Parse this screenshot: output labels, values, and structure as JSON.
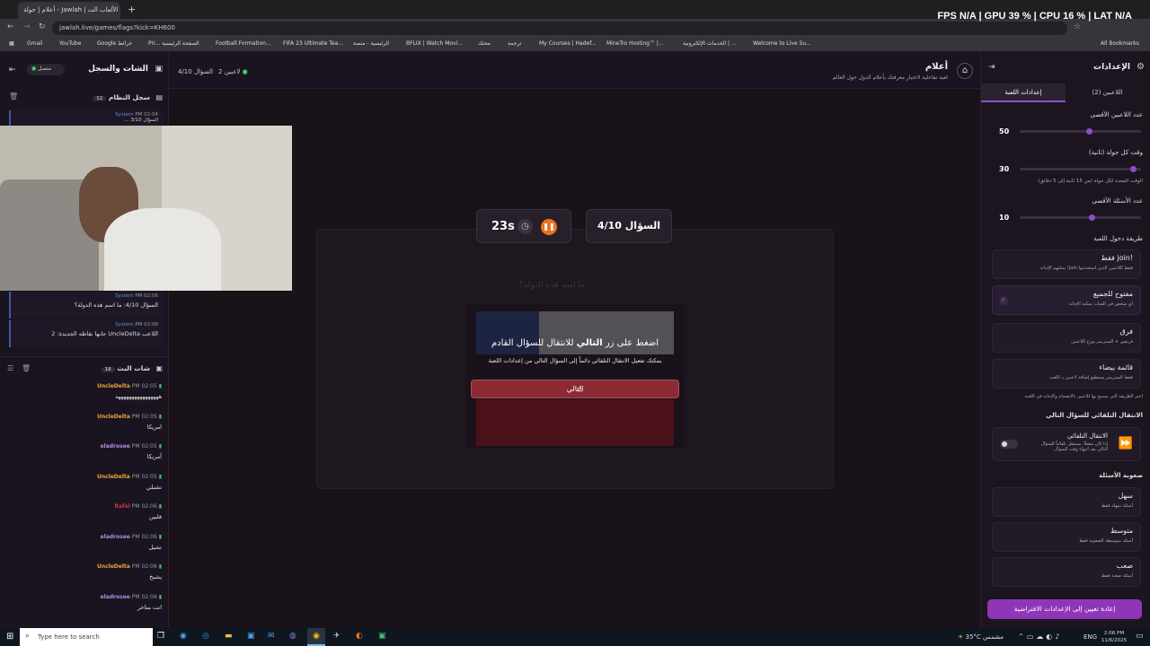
{
  "browser": {
    "tab_title": "أعلام | جولة - Jawlah | منصة الألعاب الت...",
    "url": "jawlah.live/games/flags?kick=KH600",
    "bookmarks": [
      "Gmail",
      "YouTube",
      "Google خرائط",
      "Pri... الصفحة الرئيسية",
      "Football Formation...",
      "FIFA 23 Ultimate Tea...",
      "الرئيسية - منصة",
      "BFLIX | Watch Movi...",
      "محتك",
      "ترجمة",
      "My Courses | Hadef...",
      "MineTro Hosting™ |...",
      "الخدمات الإلكترونية | ...",
      "Welcome to Live Su..."
    ],
    "all_bookmarks": "All Bookmarks"
  },
  "overlay": {
    "fps_label": "FPS",
    "fps": "N/A",
    "gpu_label": "GPU",
    "gpu": "39 %",
    "cpu_label": "CPU",
    "cpu": "16 %",
    "lat_label": "LAT",
    "lat": "N/A"
  },
  "header": {
    "title": "أعلام",
    "subtitle": "لعبة تفاعلية لاختبار معرفتك بأعلام الدول حول العالم",
    "question_counter": "السؤال 4/10",
    "players": "2 لاعبين"
  },
  "game": {
    "question_label": "السؤال 4/10",
    "timer": "23s",
    "hidden_prompt": "ما اسم هذه الدولة؟",
    "modal_title_pre": "اضغط على زر ",
    "modal_title_bold": "التالي",
    "modal_title_post": " للانتقال للسؤال القادم",
    "modal_sub": "يمكنك تفعيل الانتقال التلقائي دائماً إلى السؤال التالي من إعدادات اللعبة",
    "next_button": "التالي"
  },
  "left": {
    "title": "الشات والسجل",
    "connected": "متصل",
    "system_log": "سجل النظام",
    "system_count": "12",
    "log": [
      {
        "user": "System",
        "time": "PM 02:04",
        "text": "السؤال 3/10 ..."
      },
      {
        "user": "System",
        "time": "PM 02:06",
        "text": "السؤال 4/10: ما اسم هذه الدولة؟"
      },
      {
        "user": "System",
        "time": "PM 02:06",
        "text": "اللاعب UncleDelta جابها نقاطه الجديدة: 2"
      }
    ],
    "chat_title": "شات البث",
    "chat_count": "18",
    "chat": [
      {
        "user": "UncleDelta",
        "time": "PM 02:05",
        "text": "ههههههههههههههههه",
        "color": "#f0a23c"
      },
      {
        "user": "UncleDelta",
        "time": "PM 02:05",
        "text": "امريكا",
        "color": "#f0a23c"
      },
      {
        "user": "eladrosee",
        "time": "PM 02:05",
        "text": "أمريكا",
        "color": "#b48ce0"
      },
      {
        "user": "UncleDelta",
        "time": "PM 02:05",
        "text": "تشيلي",
        "color": "#f0a23c"
      },
      {
        "user": "Rafel",
        "time": "PM 02:06",
        "text": "فلبين",
        "color": "#d0304a"
      },
      {
        "user": "eladrosee",
        "time": "PM 02:06",
        "text": "تشيل",
        "color": "#b48ce0"
      },
      {
        "user": "UncleDelta",
        "time": "PM 02:06",
        "text": "يشبخ",
        "color": "#f0a23c"
      },
      {
        "user": "eladrosee",
        "time": "PM 02:06",
        "text": "انت متاخر",
        "color": "#b48ce0"
      }
    ]
  },
  "settings": {
    "title": "الإعدادات",
    "tab_players": "اللاعبين (2)",
    "tab_game": "إعدادات اللعبة",
    "max_players_label": "عدد اللاعبين الأقصى",
    "max_players": "50",
    "max_players_fraction": 0.42,
    "round_time_label": "وقت كل جولة (ثانية)",
    "round_time": "30",
    "round_time_fraction": 0.04,
    "round_time_hint": "الوقت المحدد لكل جولة (من 15 ثانية إلى 5 دقائق)",
    "max_questions_label": "عدد الأسئلة الأقصى",
    "max_questions": "10",
    "max_questions_fraction": 0.4,
    "join_method_label": "طريقة دخول اللعبة",
    "join_options": [
      {
        "title": "!join فقط",
        "sub": "فقط اللاعبين الذين استخدموا join! يمكنهم الإجابة"
      },
      {
        "title": "مفتوح للجميع",
        "sub": "أي شخص في الشات يمكنه الإجابة"
      },
      {
        "title": "فرق",
        "sub": "فريقين + الستريمر يوزع اللاعبين"
      },
      {
        "title": "قائمة بيضاء",
        "sub": "فقط الستريمر يستطيع إضافة لاعبين يـ اللعب"
      }
    ],
    "join_hint": "اختر الطريقة التي يسمح بها للاعبين بالانضمام والإجابة في اللعبة",
    "auto_label": "الانتقال التلقائي للسؤال التالي",
    "auto_title": "الانتقال التلقائي",
    "auto_sub": "إذا كان مفعلاً، سينتقل تلقائياً للسؤال التالي بعد انتهاء وقت السؤال.",
    "difficulty_label": "صعوبة الأسئلة",
    "difficulties": [
      {
        "title": "سهل",
        "sub": "أسئلة سهلة فقط"
      },
      {
        "title": "متوسط",
        "sub": "أسئلة متوسطة الصعوبة فقط"
      },
      {
        "title": "صعب",
        "sub": "أسئلة صعبة فقط"
      }
    ],
    "reset_button": "إعادة تعيين إلى الإعدادات الافتراضية"
  },
  "taskbar": {
    "search": "Type here to search",
    "weather": "35°C مشمس",
    "lang": "ENG",
    "time": "2:06 PM",
    "date": "11/6/2025"
  }
}
